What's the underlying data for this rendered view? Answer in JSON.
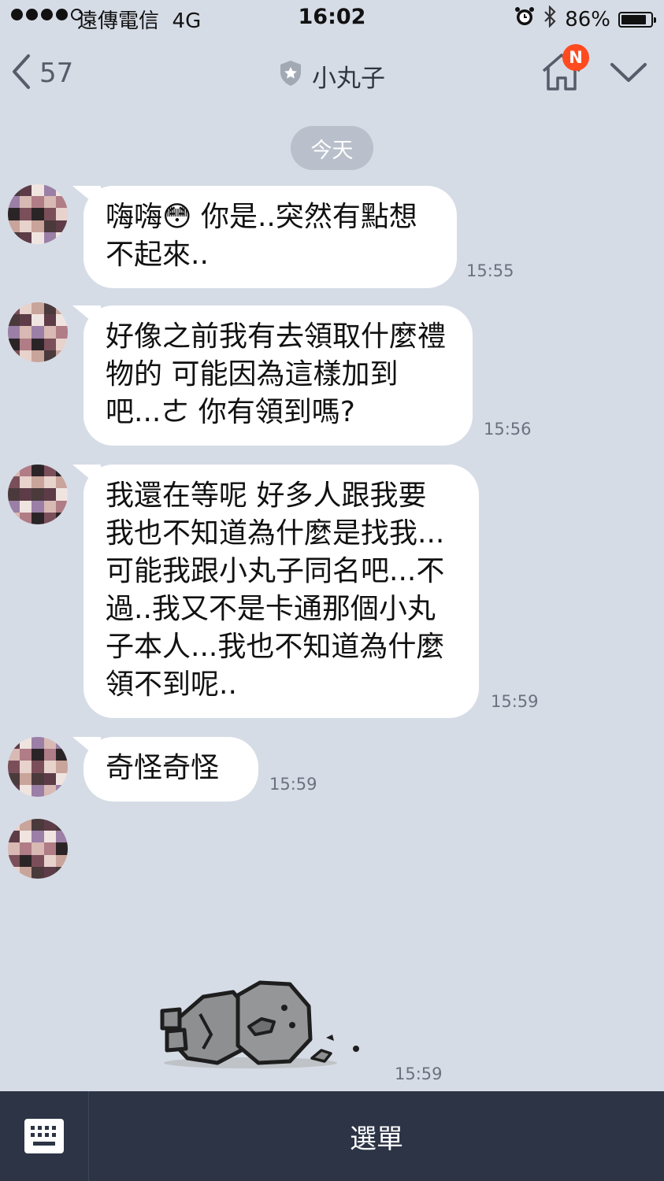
{
  "status_bar": {
    "carrier": "遠傳電信",
    "network": "4G",
    "time": "16:02",
    "battery": "86%",
    "battery_level": 0.86
  },
  "header": {
    "back_count": "57",
    "chat_title": "小丸子",
    "notification_badge": "N"
  },
  "date_divider": "今天",
  "messages": [
    {
      "text": "嗨嗨😳 你是..突然有點想不起來..",
      "time": "15:55"
    },
    {
      "text": "好像之前我有去領取什麼禮物的 可能因為這樣加到吧...ㄜ 你有領到嗎?",
      "time": "15:56"
    },
    {
      "text": "我還在等呢 好多人跟我要 我也不知道為什麼是找我...可能我跟小丸子同名吧...不過..我又不是卡通那個小丸子本人...我也不知道為什麼領不到呢..",
      "time": "15:59"
    },
    {
      "text": "奇怪奇怪",
      "time": "15:59"
    },
    {
      "sticker": "fallen-rock-sticker",
      "time": "15:59"
    }
  ],
  "footer": {
    "menu_label": "選單"
  }
}
